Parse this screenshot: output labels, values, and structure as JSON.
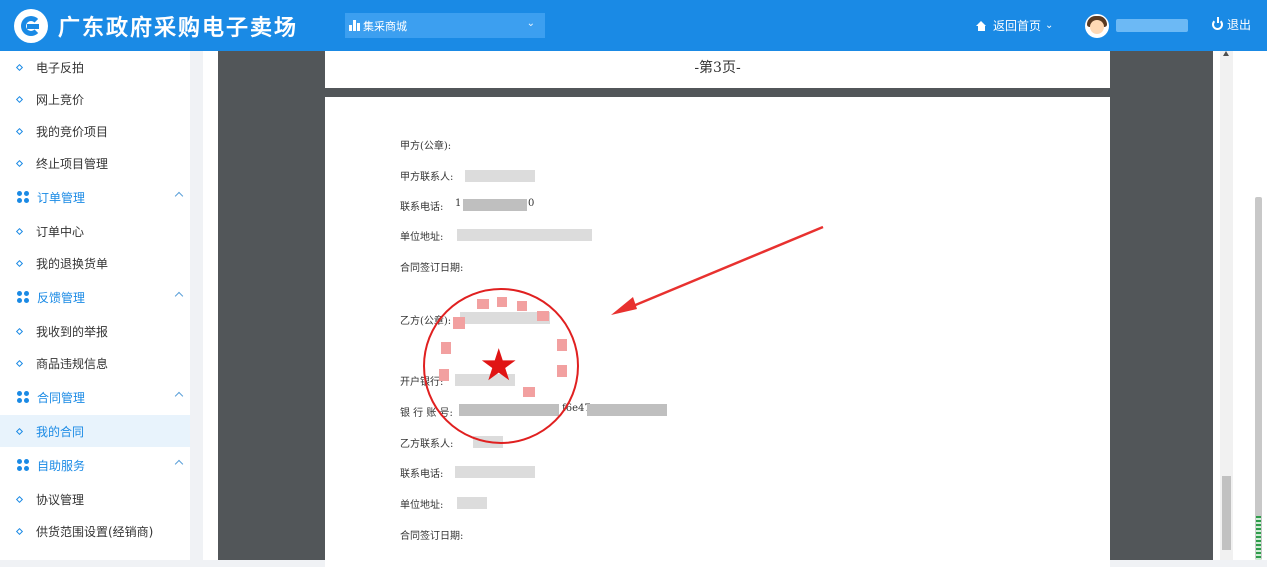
{
  "header": {
    "site_title": "广东政府采购电子卖场",
    "mall_select": "集采商城",
    "home_link": "返回首页",
    "logout": "退出"
  },
  "sidebar": {
    "items": [
      {
        "type": "sub",
        "label": "电子反拍"
      },
      {
        "type": "sub",
        "label": "网上竞价"
      },
      {
        "type": "sub",
        "label": "我的竞价项目"
      },
      {
        "type": "sub",
        "label": "终止项目管理"
      },
      {
        "type": "group",
        "label": "订单管理"
      },
      {
        "type": "sub",
        "label": "订单中心"
      },
      {
        "type": "sub",
        "label": "我的退换货单"
      },
      {
        "type": "group",
        "label": "反馈管理"
      },
      {
        "type": "sub",
        "label": "我收到的举报"
      },
      {
        "type": "sub",
        "label": "商品违规信息"
      },
      {
        "type": "group",
        "label": "合同管理"
      },
      {
        "type": "sub",
        "label": "我的合同",
        "active": true
      },
      {
        "type": "group",
        "label": "自助服务"
      },
      {
        "type": "sub",
        "label": "协议管理"
      },
      {
        "type": "sub",
        "label": "供货范围设置(经销商)"
      }
    ]
  },
  "document": {
    "page_number": "-第3页-",
    "party_a": {
      "seal_label": "甲方(公章):",
      "contact_label": "甲方联系人:",
      "phone_label": "联系电话:",
      "phone_prefix": "1",
      "phone_suffix": "0",
      "address_label": "单位地址:",
      "sign_date_label": "合同签订日期:"
    },
    "party_b": {
      "seal_label": "乙方(公章):",
      "bank_label": "开户银行:",
      "account_label": "银 行 账 号:",
      "account_partial": "f6e47",
      "contact_label": "乙方联系人:",
      "phone_label": "联系电话:",
      "address_label": "单位地址:",
      "sign_date_label": "合同签订日期:"
    },
    "stamp_star": "★"
  },
  "colors": {
    "header_bg": "#1a8ae5",
    "accent": "#1a8ae5",
    "stamp_red": "#e02020",
    "viewer_bg": "#525659"
  }
}
